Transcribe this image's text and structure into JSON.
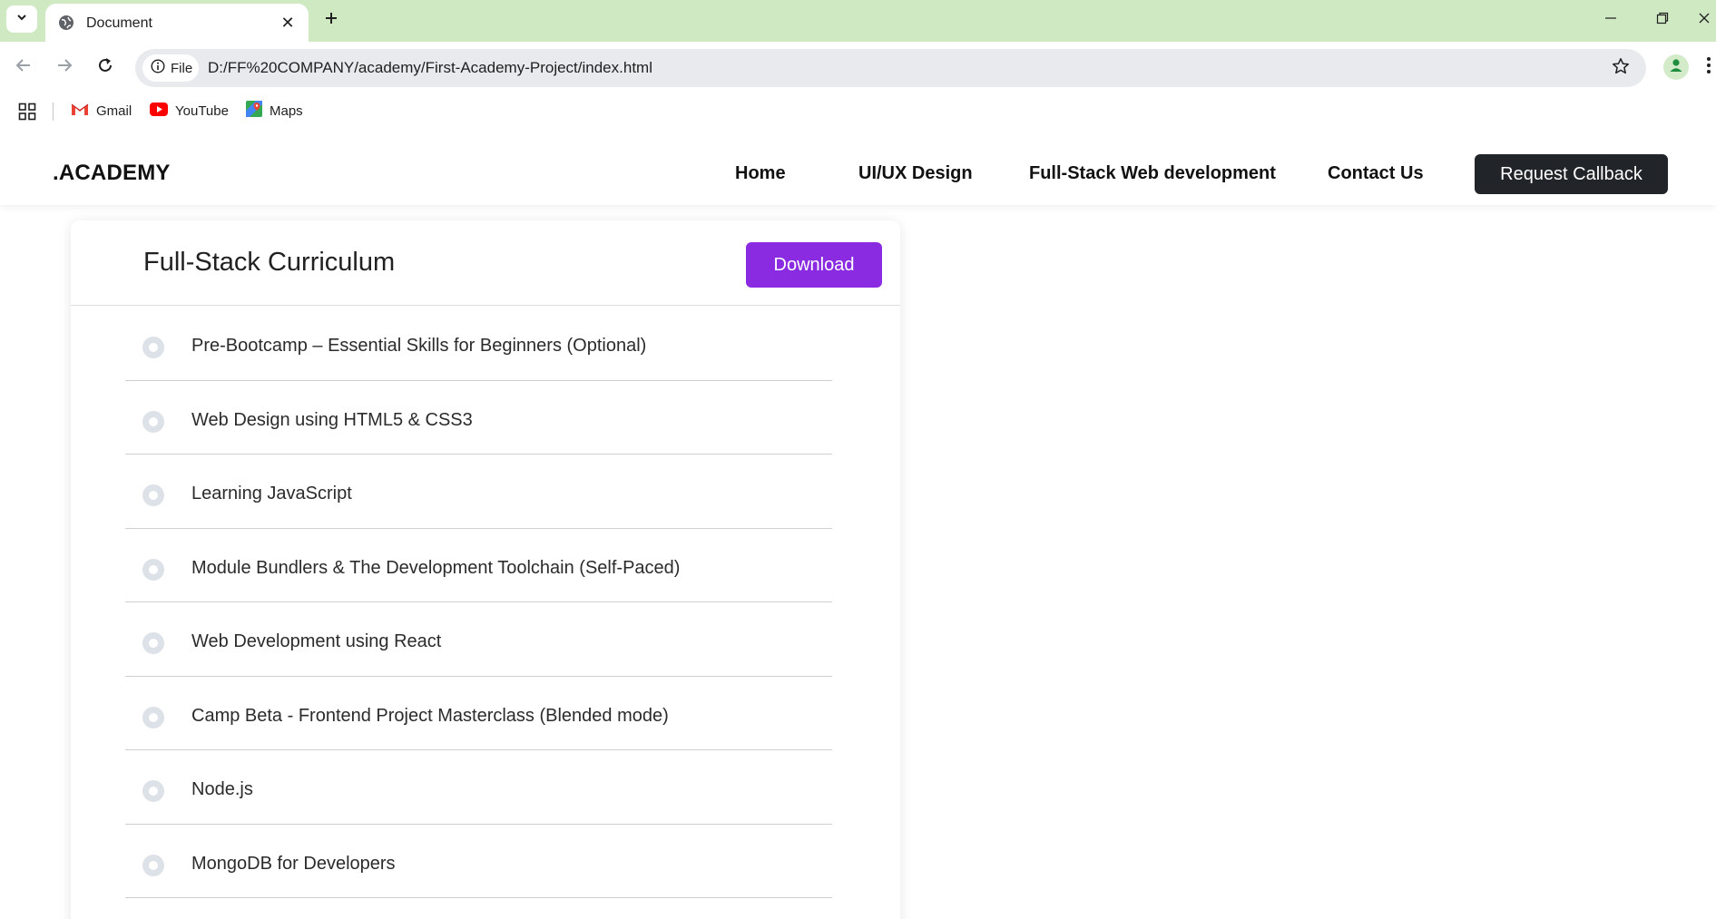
{
  "browser": {
    "tab": {
      "title": "Document"
    },
    "address_bar": {
      "chip_label": "File",
      "url": "D:/FF%20COMPANY/academy/First-Academy-Project/index.html"
    },
    "bookmarks": [
      {
        "label": "Gmail",
        "icon": "gmail-icon"
      },
      {
        "label": "YouTube",
        "icon": "youtube-icon"
      },
      {
        "label": "Maps",
        "icon": "maps-icon"
      }
    ]
  },
  "site": {
    "brand": ".ACADEMY",
    "nav": [
      {
        "label": "Home"
      },
      {
        "label": "UI/UX Design"
      },
      {
        "label": "Full-Stack Web development"
      },
      {
        "label": "Contact Us"
      }
    ],
    "cta_label": "Request Callback"
  },
  "curriculum": {
    "title": "Full-Stack Curriculum",
    "download_label": "Download",
    "modules": [
      {
        "label": "Pre-Bootcamp – Essential Skills for Beginners (Optional)"
      },
      {
        "label": "Web Design using HTML5 & CSS3"
      },
      {
        "label": "Learning JavaScript"
      },
      {
        "label": "Module Bundlers & The Development Toolchain (Self-Paced)"
      },
      {
        "label": "Web Development using React"
      },
      {
        "label": "Camp Beta - Frontend Project Masterclass (Blended mode)"
      },
      {
        "label": "Node.js"
      },
      {
        "label": "MongoDB for Developers"
      }
    ]
  },
  "colors": {
    "tabstrip": "#cfe9c3",
    "download_button": "#8a2be2",
    "callback_button": "#212529"
  }
}
